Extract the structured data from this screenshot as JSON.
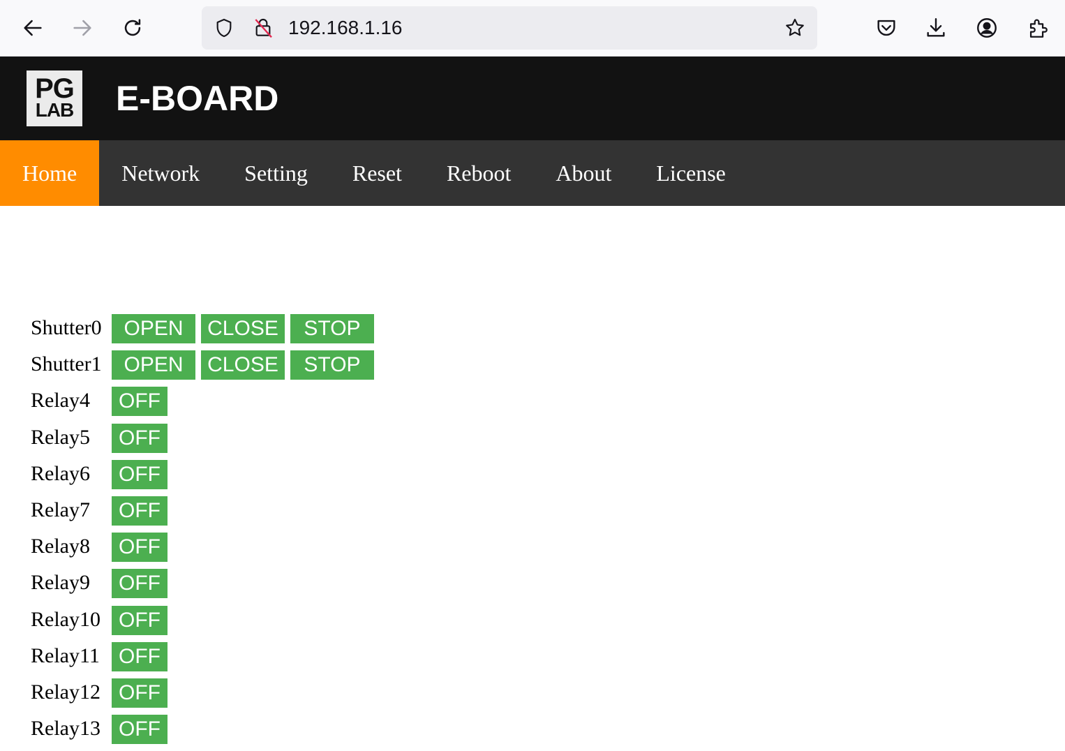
{
  "browser": {
    "url": "192.168.1.16"
  },
  "header": {
    "logo_line1": "PG",
    "logo_line2": "LAB",
    "title": "E-BOARD"
  },
  "menu": {
    "items": [
      {
        "label": "Home"
      },
      {
        "label": "Network"
      },
      {
        "label": "Setting"
      },
      {
        "label": "Reset"
      },
      {
        "label": "Reboot"
      },
      {
        "label": "About"
      },
      {
        "label": "License"
      }
    ],
    "active": "Home"
  },
  "shutters": [
    {
      "label": "Shutter0",
      "open": "OPEN",
      "close": "CLOSE",
      "stop": "STOP"
    },
    {
      "label": "Shutter1",
      "open": "OPEN",
      "close": "CLOSE",
      "stop": "STOP"
    }
  ],
  "relays": [
    {
      "label": "Relay4",
      "state": "OFF"
    },
    {
      "label": "Relay5",
      "state": "OFF"
    },
    {
      "label": "Relay6",
      "state": "OFF"
    },
    {
      "label": "Relay7",
      "state": "OFF"
    },
    {
      "label": "Relay8",
      "state": "OFF"
    },
    {
      "label": "Relay9",
      "state": "OFF"
    },
    {
      "label": "Relay10",
      "state": "OFF"
    },
    {
      "label": "Relay11",
      "state": "OFF"
    },
    {
      "label": "Relay12",
      "state": "OFF"
    },
    {
      "label": "Relay13",
      "state": "OFF"
    }
  ],
  "colors": {
    "active_menu": "#ff8c00",
    "button": "#4caf50",
    "header_bg": "#121212",
    "menu_bg": "#333333"
  }
}
